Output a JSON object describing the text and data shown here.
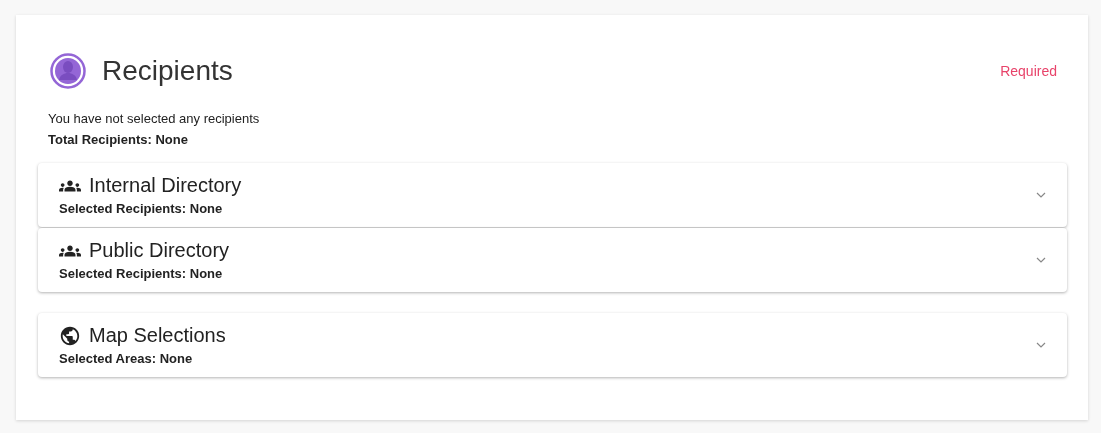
{
  "header": {
    "title": "Recipients",
    "status": "Required"
  },
  "summary": {
    "message": "You have not selected any recipients",
    "total": "Total Recipients: None"
  },
  "panel_groups": [
    {
      "panels": [
        {
          "kind": "directory",
          "title": "Internal Directory",
          "detail": "Selected Recipients: None",
          "expanded": false
        },
        {
          "kind": "directory",
          "title": "Public Directory",
          "detail": "Selected Recipients: None",
          "expanded": false
        }
      ]
    },
    {
      "panels": [
        {
          "kind": "map",
          "title": "Map Selections",
          "detail": "Selected Areas: None",
          "expanded": false
        }
      ]
    }
  ]
}
